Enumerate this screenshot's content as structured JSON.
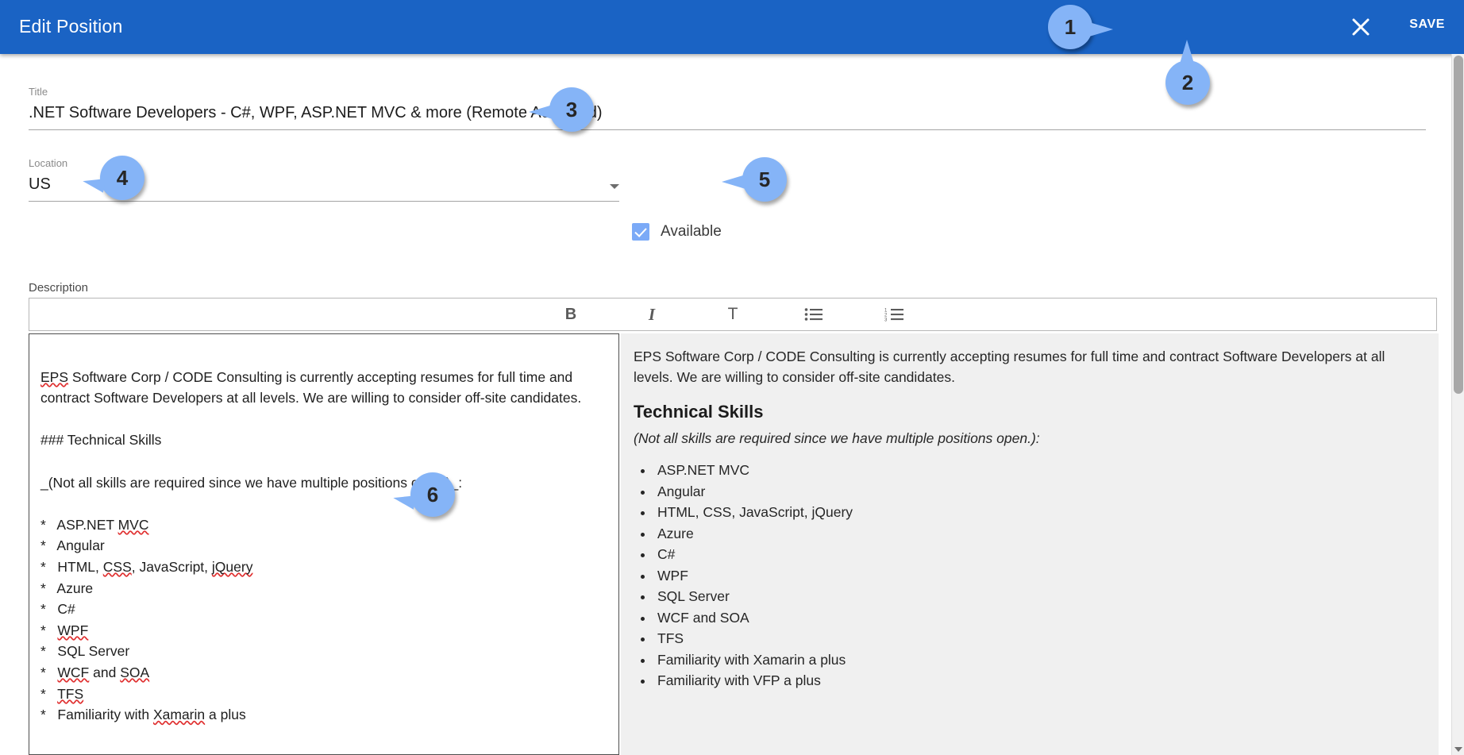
{
  "theme": {
    "header_bg": "#1a63c4",
    "callout_bg": "#85b4f7",
    "checkbox_bg": "#7baaf7",
    "preview_bg": "#f0f0f0",
    "spellcheck_underline": "#e03131"
  },
  "header": {
    "title": "Edit Position",
    "close_icon": "close-icon",
    "save_label": "SAVE"
  },
  "form": {
    "title_field": {
      "label": "Title",
      "value": ".NET Software Developers - C#, WPF, ASP.NET MVC & more (Remote Accepted)"
    },
    "location_field": {
      "label": "Location",
      "value": "US",
      "dropdown_icon": "chevron-down-icon"
    },
    "available_checkbox": {
      "label": "Available",
      "checked": true
    },
    "description_label": "Description"
  },
  "editor_toolbar": {
    "buttons": [
      {
        "name": "bold-button",
        "glyph": "B",
        "icon": "bold-icon"
      },
      {
        "name": "italic-button",
        "glyph": "I",
        "icon": "italic-icon"
      },
      {
        "name": "text-style-button",
        "glyph": "T",
        "icon": "text-icon"
      },
      {
        "name": "bulleted-list-button",
        "glyph": "",
        "icon": "bulleted-list-icon"
      },
      {
        "name": "numbered-list-button",
        "glyph": "",
        "icon": "numbered-list-icon"
      }
    ],
    "numbered_list_digits": [
      "1",
      "2",
      "3"
    ]
  },
  "markdown_source": {
    "text": "EPS Software Corp / CODE Consulting is currently accepting resumes for full time and\ncontract Software Developers at all levels. We are willing to consider off-site candidates.\n\n### Technical Skills\n\n_(Not all skills are required since we have multiple positions open.)_:\n\n*   ASP.NET MVC\n*   Angular\n*   HTML, CSS, JavaScript, jQuery\n*   Azure\n*   C#\n*   WPF\n*   SQL Server\n*   WCF and SOA\n*   TFS\n*   Familiarity with Xamarin a plus",
    "lines": [
      "EPS Software Corp / CODE Consulting is currently accepting resumes for full time and",
      "contract Software Developers at all levels. We are willing to consider off-site candidates.",
      "",
      "### Technical Skills",
      "",
      "_(Not all skills are required since we have multiple positions open.)_:",
      "",
      "*   ASP.NET MVC",
      "*   Angular",
      "*   HTML, CSS, JavaScript, jQuery",
      "*   Azure",
      "*   C#",
      "*   WPF",
      "*   SQL Server",
      "*   WCF and SOA",
      "*   TFS",
      "*   Familiarity with Xamarin a plus"
    ],
    "spellchecked_words": [
      "EPS",
      "MVC",
      "CSS",
      "jQuery",
      "WPF",
      "WCF",
      "SOA",
      "TFS",
      "Xamarin"
    ]
  },
  "preview": {
    "intro_paragraph": "EPS Software Corp / CODE Consulting is currently accepting resumes for full time and contract Software Developers at all levels. We are willing to consider off-site candidates.",
    "heading": "Technical Skills",
    "subheading": "(Not all skills are required since we have multiple positions open.):",
    "skills": [
      "ASP.NET MVC",
      "Angular",
      "HTML, CSS, JavaScript, jQuery",
      "Azure",
      "C#",
      "WPF",
      "SQL Server",
      "WCF and SOA",
      "TFS",
      "Familiarity with Xamarin a plus",
      "Familiarity with VFP a plus"
    ]
  },
  "callouts": [
    {
      "number": "1",
      "target": "close-icon"
    },
    {
      "number": "2",
      "target": "save-button"
    },
    {
      "number": "3",
      "target": "title-field"
    },
    {
      "number": "4",
      "target": "location-field"
    },
    {
      "number": "5",
      "target": "available-checkbox"
    },
    {
      "number": "6",
      "target": "markdown-editor"
    }
  ]
}
